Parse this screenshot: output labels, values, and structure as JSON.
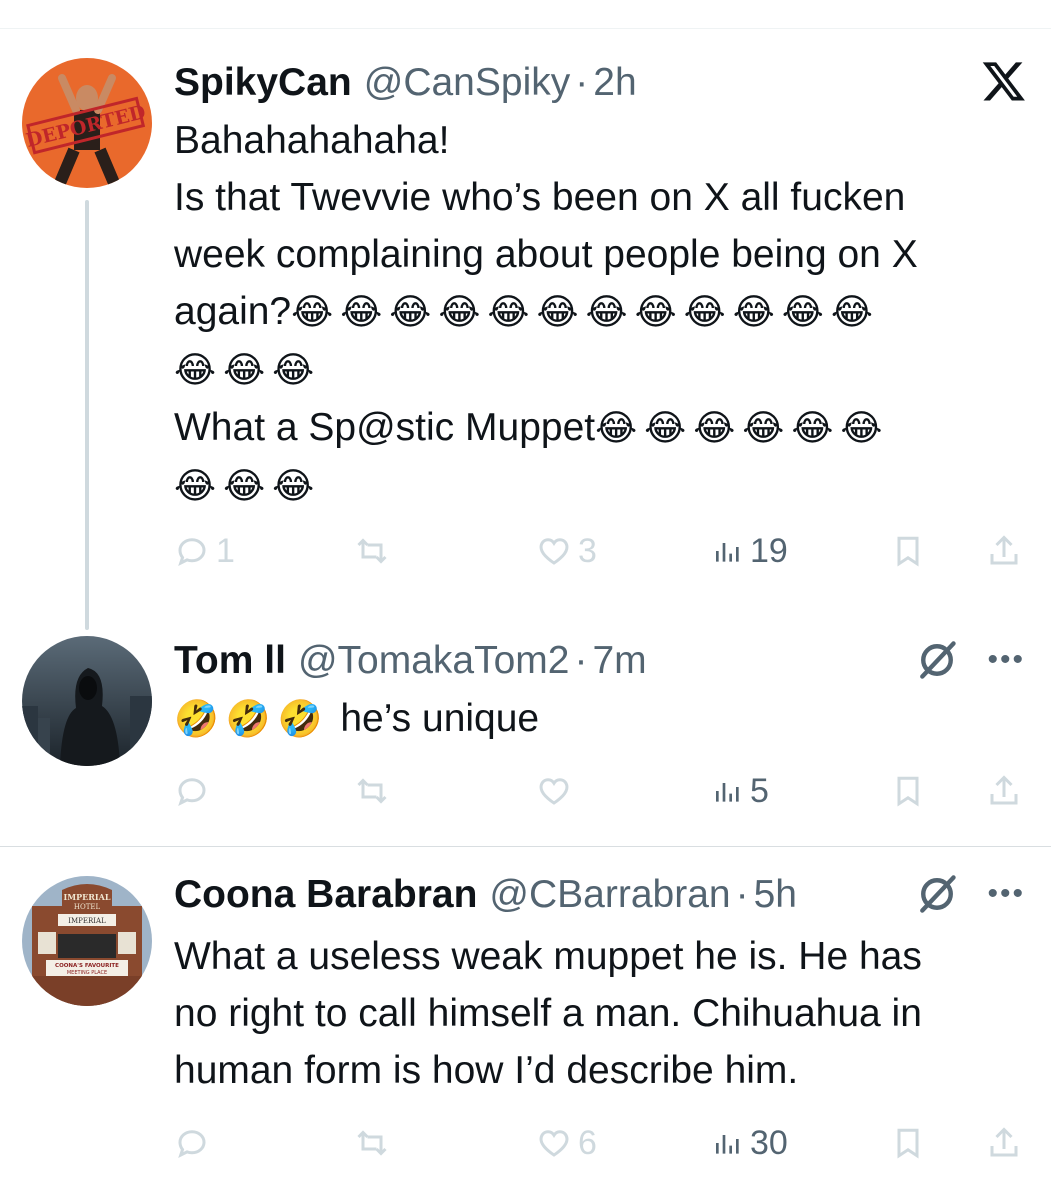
{
  "tweets": [
    {
      "name": "SpikyCan",
      "handle": "@CanSpiky",
      "time": "2h",
      "lines": [
        "Bahahahahaha!",
        "Is that Twevvie who’s been on X all fucken",
        "week complaining about people being on X",
        "again?"
      ],
      "emoji_a": "😂😂😂😂😂😂😂😂😂😂😂😂",
      "emoji_b": "😂😂😂",
      "line_c": "What a Sp@stic Muppet",
      "emoji_c": "😂😂😂😂😂😂",
      "emoji_d": "😂😂😂",
      "replies": "1",
      "reposts": "",
      "likes": "3",
      "views": "19",
      "avatar_text": "DEPORTED",
      "icons": [
        "reply-icon",
        "repost-icon",
        "like-icon",
        "views-icon",
        "bookmark-icon",
        "share-icon",
        "x-logo-icon"
      ]
    },
    {
      "name": "Tom ll",
      "handle": "@TomakaTom2",
      "time": "7m",
      "emoji": "🤣🤣🤣",
      "text": "he’s unique",
      "replies": "",
      "reposts": "",
      "likes": "",
      "views": "5",
      "icons": [
        "reply-icon",
        "repost-icon",
        "like-icon",
        "views-icon",
        "bookmark-icon",
        "share-icon",
        "grok-icon",
        "more-icon"
      ]
    },
    {
      "name": "Coona Barabran",
      "handle": "@CBarrabran",
      "time": "5h",
      "lines": [
        "What a useless weak muppet he is. He has",
        "no right to call himself a man. Chihuahua in",
        "human form is how I’d describe him."
      ],
      "replies": "",
      "reposts": "",
      "likes": "6",
      "views": "30",
      "avatar_texts": [
        "IMPERIAL",
        "HOTEL",
        "IMPERIAL",
        "COONA'S FAVOURITE",
        "MEETING PLACE"
      ],
      "icons": [
        "reply-icon",
        "repost-icon",
        "like-icon",
        "views-icon",
        "bookmark-icon",
        "share-icon",
        "grok-icon",
        "more-icon"
      ]
    }
  ],
  "colors": {
    "text": "#0f1419",
    "secondary": "#536471",
    "faded": "#cfd9de",
    "divider": "#d9dee1"
  },
  "separator": "·",
  "more_label": "•••"
}
